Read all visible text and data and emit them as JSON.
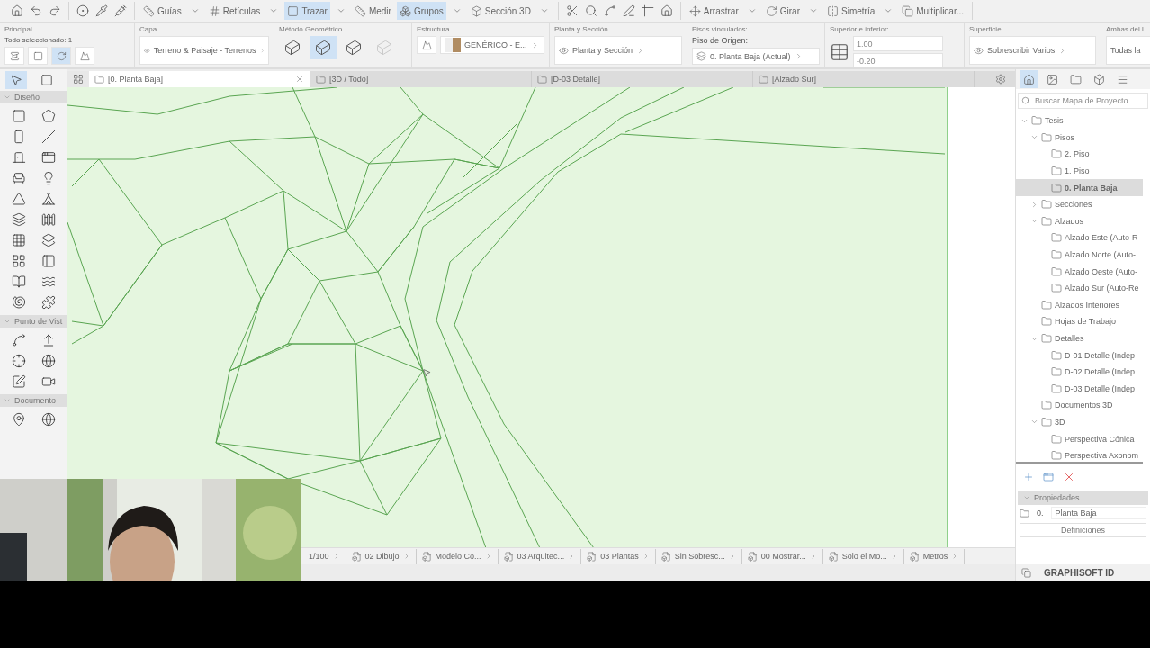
{
  "toolbar": {
    "groups": [
      {
        "items": [
          {
            "kind": "icon"
          },
          {
            "kind": "icon"
          },
          {
            "kind": "icon"
          }
        ]
      },
      {
        "items": [
          {
            "kind": "icon"
          },
          {
            "kind": "icon"
          },
          {
            "kind": "icon"
          }
        ]
      },
      {
        "items": [
          {
            "kind": "button",
            "label": "Guías",
            "selected": false,
            "menu": true
          },
          {
            "kind": "button",
            "label": "Retículas",
            "selected": false,
            "menu": true
          },
          {
            "kind": "button",
            "label": "Trazar",
            "selected": true,
            "menu": true
          },
          {
            "kind": "button",
            "label": "Medir",
            "selected": false,
            "menu": false
          },
          {
            "kind": "button",
            "label": "Grupos",
            "selected": true,
            "menu": true
          },
          {
            "kind": "button",
            "label": "Sección 3D",
            "selected": false,
            "menu": true
          }
        ]
      },
      {
        "items": [
          {
            "kind": "icon"
          },
          {
            "kind": "icon"
          },
          {
            "kind": "icon"
          },
          {
            "kind": "icon"
          },
          {
            "kind": "icon"
          },
          {
            "kind": "icon"
          }
        ]
      },
      {
        "items": [
          {
            "kind": "button",
            "label": "Arrastrar",
            "selected": false,
            "menu": true
          },
          {
            "kind": "button",
            "label": "Girar",
            "selected": false,
            "menu": true
          },
          {
            "kind": "button",
            "label": "Simetría",
            "selected": false,
            "menu": true
          },
          {
            "kind": "button",
            "label": "Multiplicar...",
            "selected": false,
            "menu": false
          }
        ]
      }
    ]
  },
  "infobox": [
    {
      "kind": "principal",
      "label": "Principal",
      "status": "Todo seleccionado: 1",
      "tools": [
        {
          "selected": false
        },
        {
          "selected": false
        },
        {
          "selected": true
        },
        {
          "selected": false
        }
      ]
    },
    {
      "kind": "select",
      "label": "Capa",
      "value": "Terreno & Paisaje - Terrenos"
    },
    {
      "kind": "methods",
      "label": "Método Geométrico",
      "options": [
        {
          "selected": false,
          "disabled": false
        },
        {
          "selected": true,
          "disabled": false
        },
        {
          "selected": false,
          "disabled": false
        },
        {
          "selected": false,
          "disabled": true
        }
      ]
    },
    {
      "kind": "structure",
      "label": "Estructura",
      "value": "GENÉRICO - E..."
    },
    {
      "kind": "select",
      "label": "Planta y Sección",
      "value": "Planta y Sección"
    },
    {
      "kind": "floors",
      "label": "Pisos vinculados:",
      "caption": "Piso de Origen:",
      "value": "0. Planta Baja (Actual)"
    },
    {
      "kind": "heights",
      "label": "Superior e inferior:",
      "values": [
        "1.00",
        "-0.20"
      ]
    },
    {
      "kind": "select",
      "label": "Superficie",
      "value": "Sobrescribir Varios"
    },
    {
      "kind": "field",
      "label": "Ambas del l",
      "value": "Todas la"
    }
  ],
  "toolbox": [
    {
      "title": "Diseño",
      "expanded": true
    },
    {
      "title": "Punto de Vist",
      "expanded": true
    },
    {
      "title": "Documento",
      "expanded": true
    }
  ],
  "tabs": [
    {
      "label": "[0. Planta Baja]",
      "selected": true
    },
    {
      "label": "[3D / Todo]",
      "selected": false
    },
    {
      "label": "[D-03 Detalle]",
      "selected": false
    },
    {
      "label": "[Alzado Sur]",
      "selected": false
    }
  ],
  "navigator": {
    "search": {
      "placeholder": "Buscar Mapa de Proyecto"
    },
    "tree": [
      {
        "label": "Tesis",
        "selected": false,
        "expanded": true,
        "children": [
          {
            "label": "Pisos",
            "selected": false,
            "expanded": true,
            "children": [
              {
                "label": "2. Piso",
                "selected": false
              },
              {
                "label": "1. Piso",
                "selected": false
              },
              {
                "label": "0. Planta Baja",
                "selected": true
              }
            ]
          },
          {
            "label": "Secciones",
            "selected": false,
            "expanded": false
          },
          {
            "label": "Alzados",
            "selected": false,
            "expanded": true,
            "children": [
              {
                "label": "Alzado Este (Auto-R",
                "selected": false
              },
              {
                "label": "Alzado Norte (Auto-",
                "selected": false
              },
              {
                "label": "Alzado Oeste (Auto-",
                "selected": false
              },
              {
                "label": "Alzado Sur (Auto-Re",
                "selected": false
              }
            ]
          },
          {
            "label": "Alzados Interiores",
            "selected": false
          },
          {
            "label": "Hojas de Trabajo",
            "selected": false
          },
          {
            "label": "Detalles",
            "selected": false,
            "expanded": true,
            "children": [
              {
                "label": "D-01 Detalle (Indep",
                "selected": false
              },
              {
                "label": "D-02 Detalle (Indep",
                "selected": false
              },
              {
                "label": "D-03 Detalle (Indep",
                "selected": false
              }
            ]
          },
          {
            "label": "Documentos 3D",
            "selected": false
          },
          {
            "label": "3D",
            "selected": false,
            "expanded": true,
            "children": [
              {
                "label": "Perspectiva Cónica",
                "selected": false
              },
              {
                "label": "Perspectiva Axonom",
                "selected": false
              }
            ]
          }
        ]
      }
    ],
    "properties": {
      "title": "Propiedades",
      "expanded": true,
      "number": "0.",
      "name": "Planta Baja",
      "button": "Definiciones"
    },
    "footer": "GRAPHISOFT ID"
  },
  "status_bar": [
    "1/100",
    "02 Dibujo",
    "Modelo Co...",
    "03 Arquitec...",
    "03 Plantas",
    "Sin Sobresc...",
    "00 Mostrar...",
    "Solo el Mo...",
    "Metros"
  ]
}
